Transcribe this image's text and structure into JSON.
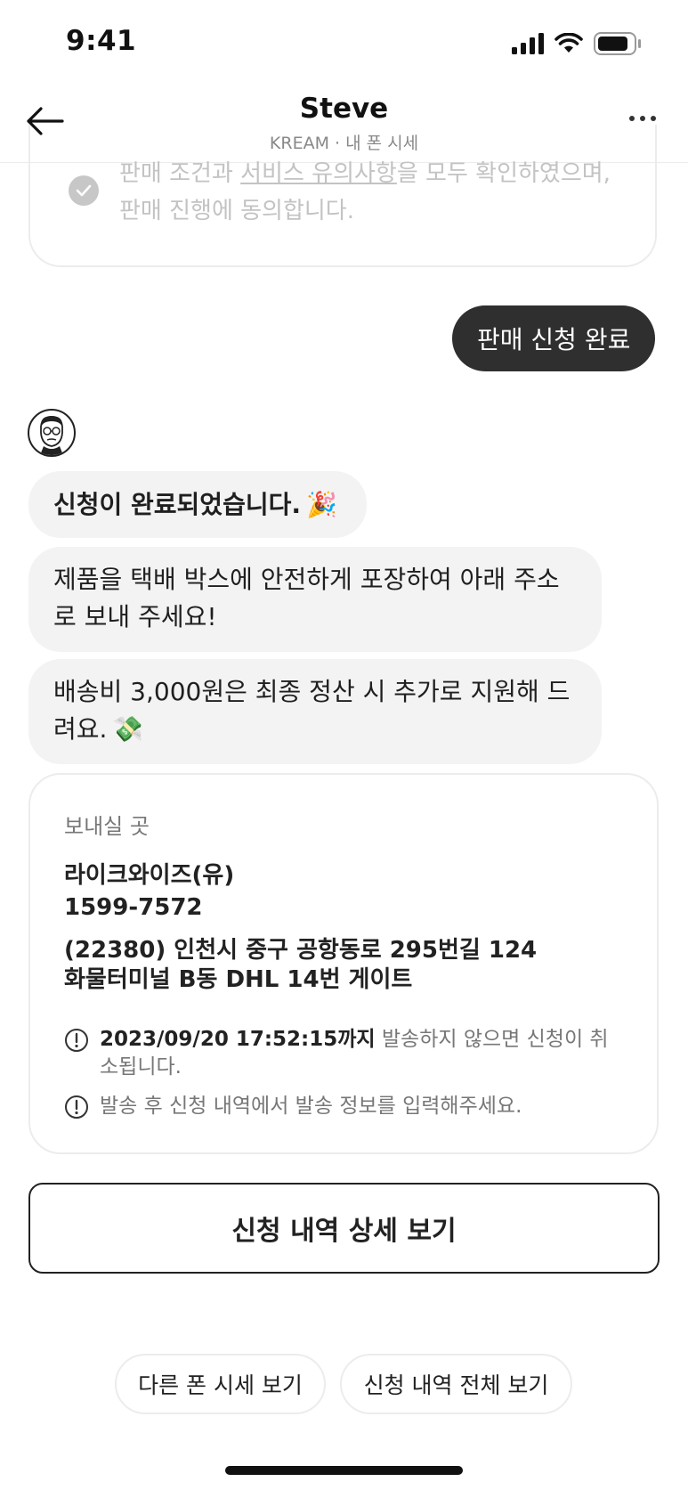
{
  "status_bar": {
    "time": "9:41"
  },
  "header": {
    "title": "Steve",
    "subtitle": "KREAM · 내 폰 시세"
  },
  "terms": {
    "text_before": "판매 조건과 ",
    "link_text": "서비스 유의사항",
    "text_after": "을 모두 확인하였으며, 판매 진행에 동의합니다."
  },
  "chat": {
    "user_message": "판매 신청 완료",
    "bot_messages": [
      {
        "text": "신청이 완료되었습니다.",
        "emoji": "🎉"
      },
      {
        "text": "제품을 택배 박스에 안전하게 포장하여 아래 주소로 보내 주세요!"
      },
      {
        "text": "배송비 3,000원은 최종 정산 시 추가로 지원해 드려요.",
        "emoji": "💸"
      }
    ]
  },
  "address_card": {
    "label": "보내실 곳",
    "name": "라이크와이즈(유)",
    "phone": "1599-7572",
    "address_line1": "(22380) 인천시 중구 공항동로 295번길 124",
    "address_line2": "화물터미널 B동 DHL 14번 게이트",
    "notices": [
      {
        "bold": "2023/09/20 17:52:15까지",
        "text": " 발송하지 않으면 신청이 취소됩니다."
      },
      {
        "bold": "",
        "text": "발송 후 신청 내역에서 발송 정보를 입력해주세요."
      }
    ]
  },
  "buttons": {
    "detail": "신청 내역 상세 보기",
    "chip_other_phone": "다른 폰 시세 보기",
    "chip_all_history": "신청 내역 전체 보기"
  }
}
